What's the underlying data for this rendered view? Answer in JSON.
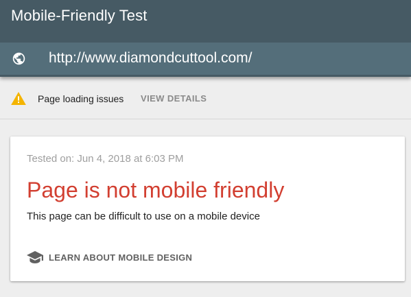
{
  "header": {
    "title": "Mobile-Friendly Test",
    "url": "http://www.diamondcuttool.com/"
  },
  "issues_bar": {
    "message": "Page loading issues",
    "action_label": "VIEW DETAILS",
    "warning_color": "#f4b400"
  },
  "result": {
    "tested_on": "Tested on: Jun 4, 2018 at 6:03 PM",
    "verdict": "Page is not mobile friendly",
    "description": "This page can be difficult to use on a mobile device",
    "learn_label": "LEARN ABOUT MOBILE DESIGN",
    "verdict_color": "#d23f31"
  },
  "icons": {
    "url": "globe-icon",
    "warning": "warning-icon",
    "learn": "mortarboard-icon"
  },
  "colors": {
    "header_bg": "#465a64",
    "url_bar_bg": "#546e7a"
  }
}
